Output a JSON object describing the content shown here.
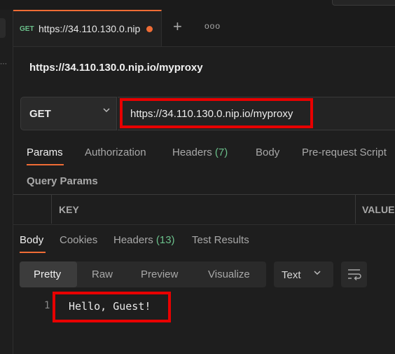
{
  "tab": {
    "method": "GET",
    "title": "https://34.110.130.0.nip"
  },
  "request": {
    "title": "https://34.110.130.0.nip.io/myproxy",
    "method": "GET",
    "url": "https://34.110.130.0.nip.io/myproxy"
  },
  "request_tabs": [
    {
      "label": "Params",
      "count": ""
    },
    {
      "label": "Authorization",
      "count": ""
    },
    {
      "label": "Headers",
      "count": "(7)"
    },
    {
      "label": "Body",
      "count": ""
    },
    {
      "label": "Pre-request Script",
      "count": ""
    }
  ],
  "query_params": {
    "title": "Query Params",
    "columns": [
      "KEY",
      "VALUE"
    ]
  },
  "response_tabs": [
    {
      "label": "Body",
      "count": ""
    },
    {
      "label": "Cookies",
      "count": ""
    },
    {
      "label": "Headers",
      "count": "(13)"
    },
    {
      "label": "Test Results",
      "count": ""
    }
  ],
  "view_modes": [
    "Pretty",
    "Raw",
    "Preview",
    "Visualize"
  ],
  "format": "Text",
  "response_body": {
    "line": "1",
    "text": "Hello, Guest!"
  },
  "colors": {
    "accent": "#ef6c35",
    "highlight": "#e80000",
    "count": "#6bc08b"
  }
}
